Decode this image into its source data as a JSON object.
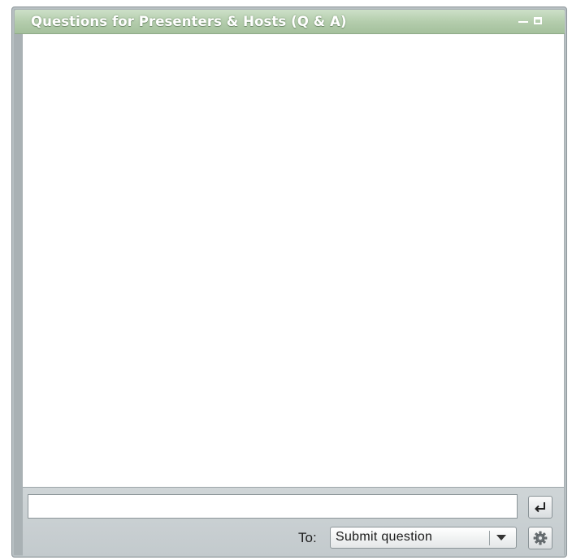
{
  "window": {
    "title": "Questions for Presenters & Hosts (Q & A)",
    "title_bar_color": "#b4cdad",
    "frame_color": "#a9b1b4"
  },
  "title_controls": {
    "minimize_icon": "minimize-icon",
    "maximize_icon": "maximize-icon"
  },
  "question_input": {
    "value": "",
    "placeholder": ""
  },
  "send_button": {
    "icon": "enter-return-icon"
  },
  "recipient": {
    "label": "To:",
    "selected": "Submit question",
    "icon": "chevron-down-icon"
  },
  "settings_button": {
    "icon": "gear-icon"
  }
}
